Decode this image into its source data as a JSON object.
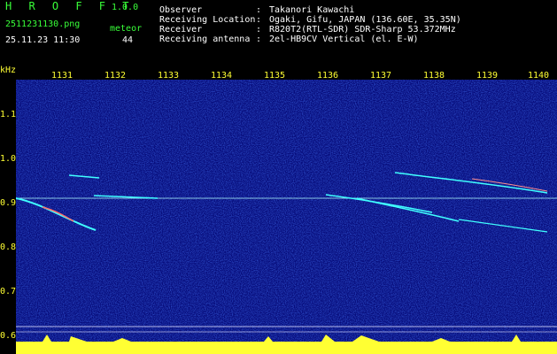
{
  "header": {
    "app_name": "H R O F F T",
    "app_version": "1.0.0",
    "filename": "2511231130.png",
    "category": "meteor",
    "datetime": "25.11.23 11:30",
    "count": "44",
    "meta": [
      {
        "label": "Observer",
        "value": "Takanori Kawachi"
      },
      {
        "label": "Receiving Location",
        "value": "Ogaki, Gifu, JAPAN (136.60E, 35.35N)"
      },
      {
        "label": "Receiver",
        "value": "R820T2(RTL-SDR) SDR-Sharp 53.372MHz"
      },
      {
        "label": "Receiving antenna",
        "value": "2el-HB9CV Vertical (el. E-W)"
      }
    ],
    "colon": ":"
  },
  "axes": {
    "y_unit": "kHz",
    "y_ticks": [
      "1.1",
      "1.0",
      "0.9",
      "0.8",
      "0.7",
      "0.6"
    ],
    "x_ticks": [
      "1131",
      "1132",
      "1133",
      "1134",
      "1135",
      "1136",
      "1137",
      "1138",
      "1139",
      "1140"
    ]
  },
  "colors": {
    "background": "#000000",
    "spectrum_bg": "#060b7a",
    "header_green": "#39ff39",
    "header_white": "#ffffff",
    "axis_yellow": "#ffff33",
    "signal_cyan": "#40ffff",
    "carrier": "#b0ffff"
  }
}
